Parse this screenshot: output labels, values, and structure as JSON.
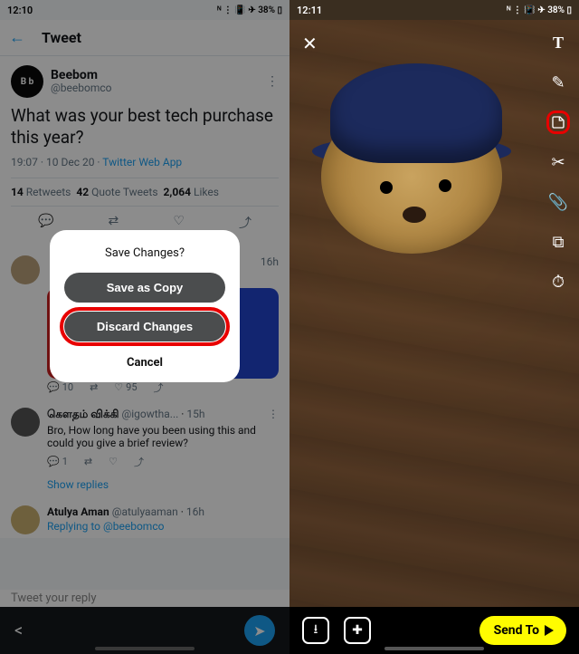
{
  "left": {
    "status": {
      "time": "12:10",
      "icons": "ᴺ ⋮ 📳 ✈ 38% ▯"
    },
    "header": {
      "title": "Tweet"
    },
    "tweet": {
      "avatar_initials": "B b",
      "display_name": "Beebom",
      "handle": "@beebomco",
      "text": "What was your best tech purchase this year?",
      "time": "19:07",
      "date": "10 Dec 20",
      "source": "Twitter Web App",
      "retweets_n": "14",
      "retweets_l": "Retweets",
      "quotes_n": "42",
      "quotes_l": "Quote Tweets",
      "likes_n": "2,064",
      "likes_l": "Likes"
    },
    "reply1": {
      "time": "16h",
      "comments": "10",
      "likes": "95"
    },
    "reply2": {
      "name": "கௌதம் விக்கி",
      "handle": "@igowtha...",
      "time": "15h",
      "body": "Bro, How long have you been using this and could you give a brief review?",
      "comments": "1",
      "show_replies": "Show replies"
    },
    "reply3": {
      "name": "Atulya Aman",
      "handle": "@atulyaaman",
      "time": "16h",
      "body": "Replying to @beebomco"
    },
    "reply_placeholder": "Tweet your reply",
    "modal": {
      "title": "Save Changes?",
      "save_copy": "Save as Copy",
      "discard": "Discard Changes",
      "cancel": "Cancel"
    }
  },
  "right": {
    "status": {
      "time": "12:11",
      "icons": "ᴺ ⋮ 📳 ✈ 38% ▯"
    },
    "send_to": "Send To"
  }
}
